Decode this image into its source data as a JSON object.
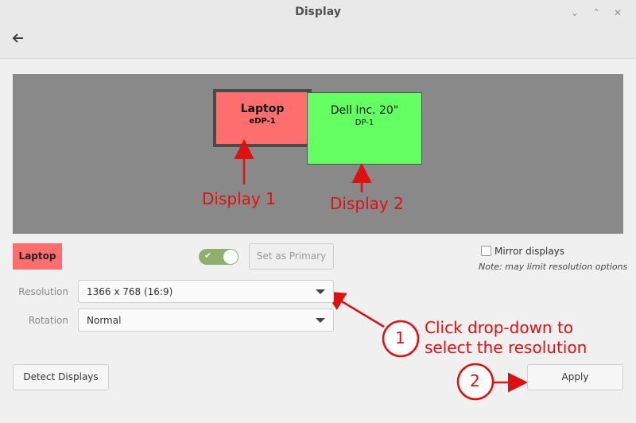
{
  "window": {
    "title": "Display"
  },
  "toolbar": {
    "back_icon": "arrow-left-icon"
  },
  "arrangement": {
    "monitors": [
      {
        "name": "Laptop",
        "connector": "eDP-1",
        "color": "#ff6e6e"
      },
      {
        "name": "Dell Inc. 20\"",
        "connector": "DP-1",
        "color": "#63ff63"
      }
    ]
  },
  "annotations": {
    "display1": "Display 1",
    "display2": "Display 2",
    "step1_number": "1",
    "step1_text_line1": "Click drop-down to",
    "step1_text_line2": "select the resolution",
    "step2_number": "2",
    "color": "#e01010"
  },
  "settings": {
    "selected_monitor": "Laptop",
    "enabled": true,
    "set_primary_label": "Set as Primary",
    "mirror_label": "Mirror displays",
    "mirror_checked": false,
    "mirror_note": "Note: may limit resolution options",
    "resolution_label": "Resolution",
    "resolution_value": "1366 x 768 (16:9)",
    "rotation_label": "Rotation",
    "rotation_value": "Normal"
  },
  "footer": {
    "detect_label": "Detect Displays",
    "apply_label": "Apply"
  }
}
